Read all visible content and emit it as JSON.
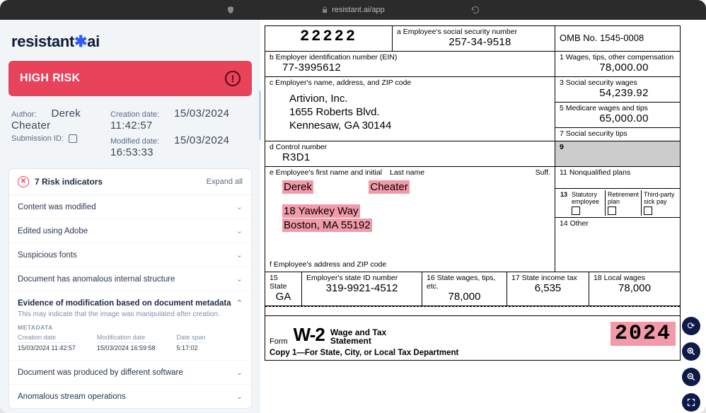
{
  "browser": {
    "url": "resistant.ai/app"
  },
  "logo": {
    "left": "resistant",
    "right": "ai"
  },
  "risk_banner": {
    "label": "HIGH RISK",
    "icon_char": "!"
  },
  "meta": {
    "author_label": "Author:",
    "author_value": "Derek Cheater",
    "creation_label": "Creation date:",
    "creation_value": "15/03/2024 11:42:57",
    "submission_label": "Submission ID:",
    "modified_label": "Modified date:",
    "modified_value": "15/03/2024 16:53:33"
  },
  "indicators": {
    "header": "7 Risk indicators",
    "expand_all": "Expand all",
    "items": [
      "Content was modified",
      "Edited using Adobe",
      "Suspicious fonts",
      "Document has anomalous internal structure"
    ],
    "expanded": {
      "title": "Evidence of modification based on document metadata",
      "sub": "This may indicate that the image was manipulated after creation.",
      "md_label": "METADATA",
      "cols": [
        {
          "h": "Creation date",
          "v": "15/03/2024 11:42:57"
        },
        {
          "h": "Modification date",
          "v": "15/03/2024 16:59:58"
        },
        {
          "h": "Date span",
          "v": "5:17:02"
        }
      ]
    },
    "items_after": [
      "Document was produced by different software",
      "Anomalous stream operations"
    ]
  },
  "w2": {
    "box22222": "22222",
    "box_a_label": "a  Employee's social security number",
    "box_a_value": "257-34-9518",
    "omb": "OMB No. 1545-0008",
    "box_b_label": "b  Employer identification number (EIN)",
    "box_b_value": "77-3995612",
    "box1_label": "1   Wages, tips, other compensation",
    "box1_value": "78,000.00",
    "box_c_label": "c  Employer's name, address, and ZIP code",
    "employer_name": "Artivion, Inc.",
    "employer_addr1": "1655 Roberts Blvd.",
    "employer_addr2": "Kennesaw, GA 30144",
    "box3_label": "3   Social security wages",
    "box3_value": "54,239.92",
    "box5_label": "5   Medicare wages and tips",
    "box5_value": "65,000.00",
    "box7_label": "7   Social security tips",
    "box_d_label": "d  Control number",
    "box_d_value": "R3D1",
    "box9_label": "9",
    "box_e_label": "e  Employee's first name and initial",
    "last_name_label": "Last name",
    "suff_label": "Suff.",
    "first_name": "Derek",
    "last_name": "Cheater",
    "emp_addr1": "18 Yawkey Way",
    "emp_addr2": "Boston, MA 55192",
    "box11_label": "11   Nonqualified plans",
    "box13a": "Statutory employee",
    "box13b": "Retirement plan",
    "box13c": "Third-party sick pay",
    "box13_num": "13",
    "box14_label": "14   Other",
    "box_f_label": "f   Employee's address and ZIP code",
    "box15_label": "15  State",
    "box15_value": "GA",
    "emp_state_id_label": "Employer's state ID number",
    "emp_state_id_value": "319-9921-4512",
    "box16_label": "16  State wages, tips, etc.",
    "box16_value": "78,000",
    "box17_label": "17   State income tax",
    "box17_value": "6,535",
    "box18_label": "18  Local wages",
    "box18_value": "78,000",
    "form_label": "Form",
    "w2_big": "W-2",
    "wage_line1": "Wage and Tax",
    "wage_line2": "Statement",
    "year": "2024",
    "copy_line": "Copy 1—For State, City, or Local Tax Department"
  }
}
